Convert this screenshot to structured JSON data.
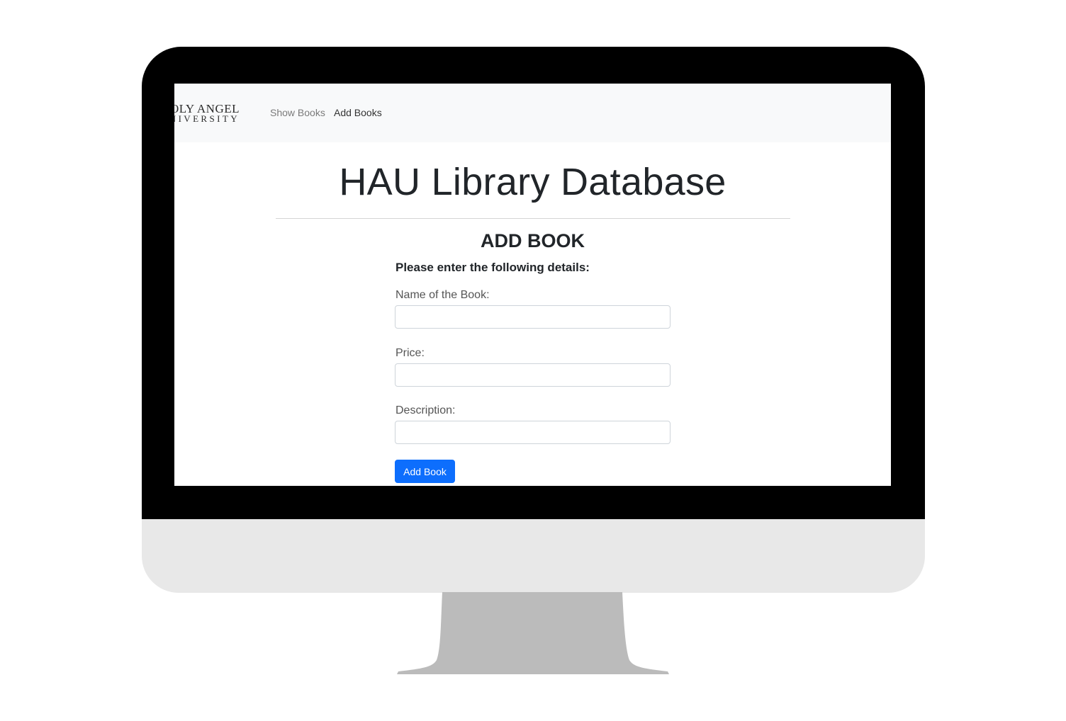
{
  "colors": {
    "bezel": "#000000",
    "chin": "#e8e8e8",
    "stand": "#bbbbbb",
    "navbar_bg": "#f8f9fa",
    "primary_button": "#0d6efd"
  },
  "brand": {
    "line1": "OLY ANGEL",
    "line2": "NIVERSITY"
  },
  "nav": {
    "items": [
      {
        "label": "Show Books",
        "active": false
      },
      {
        "label": "Add Books",
        "active": true
      }
    ]
  },
  "page": {
    "title": "HAU Library Database"
  },
  "form": {
    "heading": "ADD BOOK",
    "instructions": "Please enter the following details:",
    "fields": [
      {
        "label": "Name of the Book:",
        "value": "",
        "placeholder": ""
      },
      {
        "label": "Price:",
        "value": "",
        "placeholder": ""
      },
      {
        "label": "Description:",
        "value": "",
        "placeholder": ""
      }
    ],
    "submit_label": "Add Book"
  }
}
